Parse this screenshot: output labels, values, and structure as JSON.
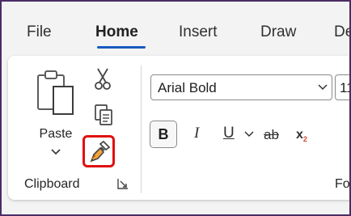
{
  "tabs": [
    {
      "label": "File"
    },
    {
      "label": "Home"
    },
    {
      "label": "Insert"
    },
    {
      "label": "Draw"
    },
    {
      "label": "De"
    }
  ],
  "active_tab": "Home",
  "colors": {
    "accent": "#185abd",
    "highlight_box": "#e01010",
    "frame_border": "#4a2d66"
  },
  "clipboard": {
    "paste_label": "Paste",
    "group_label": "Clipboard",
    "icons": [
      "paste-icon",
      "cut-icon",
      "copy-icon",
      "format-painter-icon",
      "dialog-launcher-icon"
    ]
  },
  "font": {
    "font_name": "Arial Bold",
    "font_size": "11",
    "bold_label": "B",
    "italic_label": "I",
    "underline_label": "U",
    "strike_label": "ab",
    "subscript_label": "x",
    "subscript_index": "2",
    "group_label": "Fo"
  }
}
